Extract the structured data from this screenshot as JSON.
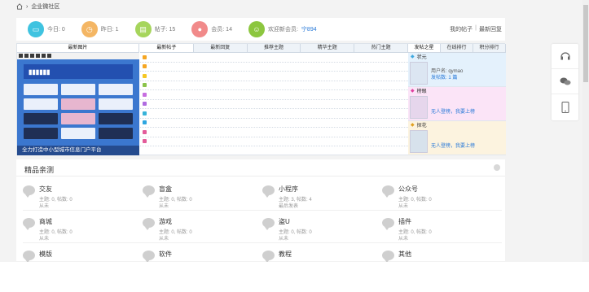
{
  "breadcrumb": {
    "text": "企业微社区"
  },
  "stats": [
    {
      "label": "今日: 0",
      "color": "#3fc3e0",
      "icon": "book-icon"
    },
    {
      "label": "昨日: 1",
      "color": "#f4b664",
      "icon": "clock-icon"
    },
    {
      "label": "帖子: 15",
      "color": "#a6d55c",
      "icon": "post-icon"
    },
    {
      "label": "会员: 14",
      "color": "#f18a8a",
      "icon": "member-icon"
    }
  ],
  "welcome": {
    "prefix": "欢迎新会员:",
    "name": "宁894",
    "color": "#8cc63f"
  },
  "links": {
    "my_posts": "我的帖子",
    "latest_reply": "最新回复",
    "sep": "|"
  },
  "tabs_left": [
    "最新图片"
  ],
  "tabs_mid": [
    "最新帖子",
    "最新回复",
    "推荐主题",
    "精华主题",
    "热门主题"
  ],
  "tabs_right": [
    "发帖之星",
    "在线排行",
    "积分排行"
  ],
  "image_caption": "全力打造中小型城市信息门户平台",
  "list_colors": [
    "#f5a623",
    "#f5a623",
    "#f5c723",
    "#8bc34a",
    "#c76ee0",
    "#b06be0",
    "#37b3d9",
    "#2da6e0",
    "#e35b9a",
    "#e35b9a"
  ],
  "ranks": [
    {
      "title": "状元",
      "user": "用户名: qymao",
      "posts": "发帖数: 1 篇",
      "style": "rk1"
    },
    {
      "title": "榜眼",
      "user": "无人登榜，我要上榜",
      "posts": "",
      "style": "rk2"
    },
    {
      "title": "探花",
      "user": "无人登榜，我要上榜",
      "posts": "",
      "style": "rk3"
    }
  ],
  "section": {
    "title": "精品亲测"
  },
  "forums": [
    {
      "name": "交友",
      "stat": "主题: 0, 帖数: 0",
      "last": "从未"
    },
    {
      "name": "盲盒",
      "stat": "主题: 0, 帖数: 0",
      "last": "从未"
    },
    {
      "name": "小程序",
      "stat": "主题: 3, 帖数: 4",
      "last": "最后发表"
    },
    {
      "name": "公众号",
      "stat": "主题: 0, 帖数: 0",
      "last": "从未"
    },
    {
      "name": "商城",
      "stat": "主题: 0, 帖数: 0",
      "last": "从未"
    },
    {
      "name": "游戏",
      "stat": "主题: 0, 帖数: 0",
      "last": "从未"
    },
    {
      "name": "盗U",
      "stat": "主题: 0, 帖数: 0",
      "last": "从未"
    },
    {
      "name": "插件",
      "stat": "主题: 0, 帖数: 0",
      "last": "从未"
    },
    {
      "name": "模版",
      "stat": "",
      "last": ""
    },
    {
      "name": "软件",
      "stat": "",
      "last": ""
    },
    {
      "name": "教程",
      "stat": "",
      "last": ""
    },
    {
      "name": "其他",
      "stat": "",
      "last": ""
    }
  ]
}
